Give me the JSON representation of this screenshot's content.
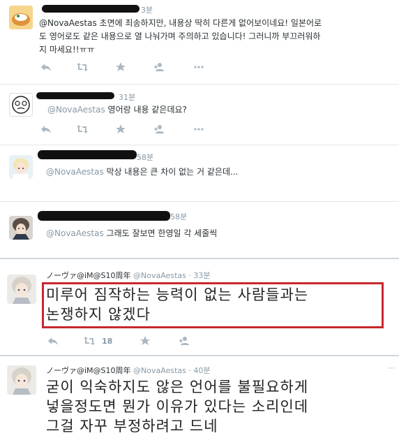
{
  "tweets": [
    {
      "time": "3분",
      "lines": [
        "@NovaAestas 초면에 죄송하지만, 내용상 딱히 다른게 없어보이네요! 일본어로",
        "도 영어로도 같은 내용으로 열 나눠가며 주의하고 있습니다! 그러니까 부끄러워하",
        "지 마세요!!ㅠㅠ"
      ]
    },
    {
      "time": "31분",
      "mention": "@NovaAestas",
      "body": " 영어랑 내용 같은데요?"
    },
    {
      "time": "58분",
      "mention": "@NovaAestas",
      "body": " 막상 내용은 큰 차이 없는 거 같은데..."
    },
    {
      "time": "58분",
      "mention": "@NovaAestas",
      "body": " 그래도 잘보면 한영일 각 세줄씩"
    }
  ],
  "tweet5": {
    "name": "ノーヴァ@iM@S10周年",
    "handle": "@NovaAestas",
    "time": "33분",
    "lines": [
      "미루어 짐작하는 능력이 없는 사람들과는",
      "논쟁하지 않겠다"
    ],
    "retweets": "18"
  },
  "tweet6": {
    "name": "ノーヴァ@iM@S10周年",
    "handle": "@NovaAestas",
    "time": "40분",
    "lines": [
      "굳이 익숙하지도 않은 언어를 불필요하게",
      "넣을정도면 뭔가 이유가 있다는 소리인데",
      "그걸 자꾸 부정하려고 드네"
    ]
  },
  "colors": {
    "highlight": "#c8282e",
    "muted": "#8899a6",
    "text": "#292f33"
  }
}
